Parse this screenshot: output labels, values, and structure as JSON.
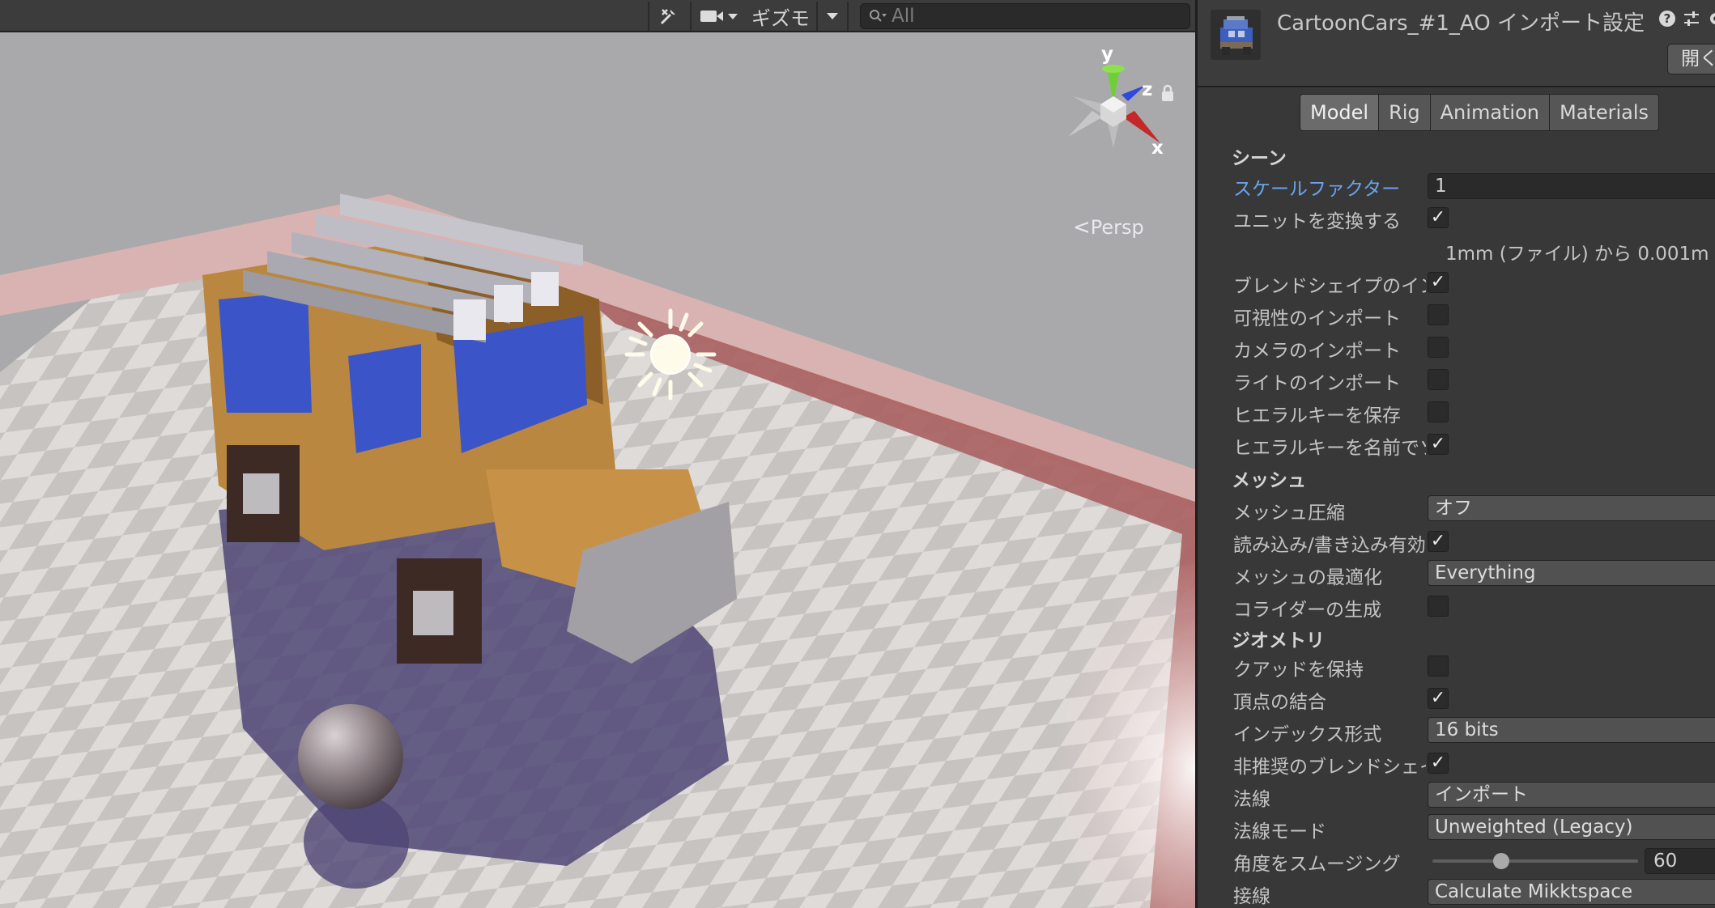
{
  "scene": {
    "toolbar": {
      "gizmo_label": "ギズモ",
      "search_placeholder": "All"
    },
    "view_mode": "Persp",
    "axes": {
      "x": "x",
      "y": "y",
      "z": "z"
    }
  },
  "inspector": {
    "title": "CartoonCars_#1_AO インポート設定",
    "open_button": "開く",
    "tabs": [
      "Model",
      "Rig",
      "Animation",
      "Materials"
    ],
    "active_tab": "Model",
    "sections": {
      "scene": "シーン",
      "mesh": "メッシュ",
      "geometry": "ジオメトリ"
    },
    "props": {
      "scale_factor": {
        "label": "スケールファクター",
        "value": "1"
      },
      "convert_units": {
        "label": "ユニットを変換する",
        "checked": true
      },
      "unit_info": "1mm (ファイル) から 0.001m",
      "import_blendshapes": {
        "label": "ブレンドシェイプのインポート",
        "checked": true
      },
      "import_visibility": {
        "label": "可視性のインポート",
        "checked": false
      },
      "import_cameras": {
        "label": "カメラのインポート",
        "checked": false
      },
      "import_lights": {
        "label": "ライトのインポート",
        "checked": false
      },
      "preserve_hierarchy": {
        "label": "ヒエラルキーを保存",
        "checked": false
      },
      "sort_hierarchy": {
        "label": "ヒエラルキーを名前でソート",
        "checked": true
      },
      "mesh_compression": {
        "label": "メッシュ圧縮",
        "value": "オフ"
      },
      "read_write": {
        "label": "読み込み/書き込み有効",
        "checked": true
      },
      "optimize_mesh": {
        "label": "メッシュの最適化",
        "value": "Everything"
      },
      "generate_colliders": {
        "label": "コライダーの生成",
        "checked": false
      },
      "keep_quads": {
        "label": "クアッドを保持",
        "checked": false
      },
      "weld_vertices": {
        "label": "頂点の結合",
        "checked": true
      },
      "index_format": {
        "label": "インデックス形式",
        "value": "16 bits"
      },
      "legacy_blendshape_normals": {
        "label": "非推奨のブレンドシェイプ法線",
        "checked": true
      },
      "normals": {
        "label": "法線",
        "value": "インポート"
      },
      "normals_mode": {
        "label": "法線モード",
        "value": "Unweighted (Legacy)"
      },
      "smoothing_angle": {
        "label": "角度をスムージング",
        "value": "60",
        "fraction": 0.333
      },
      "tangents": {
        "label": "接線",
        "value": "Calculate Mikktspace"
      }
    }
  }
}
